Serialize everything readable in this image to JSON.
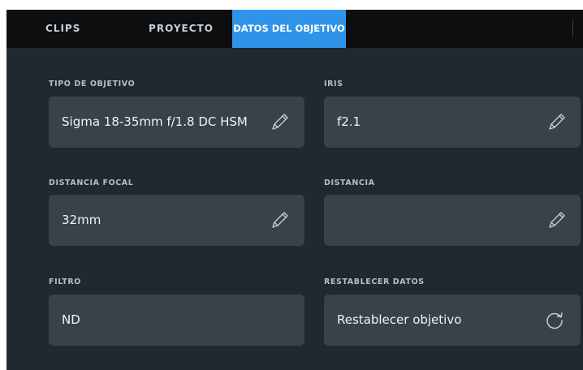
{
  "tabs": [
    {
      "label": "CLIPS"
    },
    {
      "label": "PROYECTO"
    },
    {
      "label": "DATOS DEL OBJETIVO"
    }
  ],
  "accent_color": "#2f93e8",
  "fields": {
    "lens_type": {
      "label": "TIPO DE OBJETIVO",
      "value": "Sigma 18-35mm f/1.8 DC HSM",
      "icon": "pencil-icon"
    },
    "iris": {
      "label": "IRIS",
      "value": "f2.1",
      "icon": "pencil-icon"
    },
    "focal_length": {
      "label": "DISTANCIA FOCAL",
      "value": "32mm",
      "icon": "pencil-icon"
    },
    "distance": {
      "label": "DISTANCIA",
      "value": "",
      "icon": "pencil-icon"
    },
    "filter": {
      "label": "FILTRO",
      "value": "ND"
    },
    "reset": {
      "label": "RESTABLECER DATOS",
      "value": "Restablecer objetivo",
      "icon": "reset-icon"
    }
  }
}
